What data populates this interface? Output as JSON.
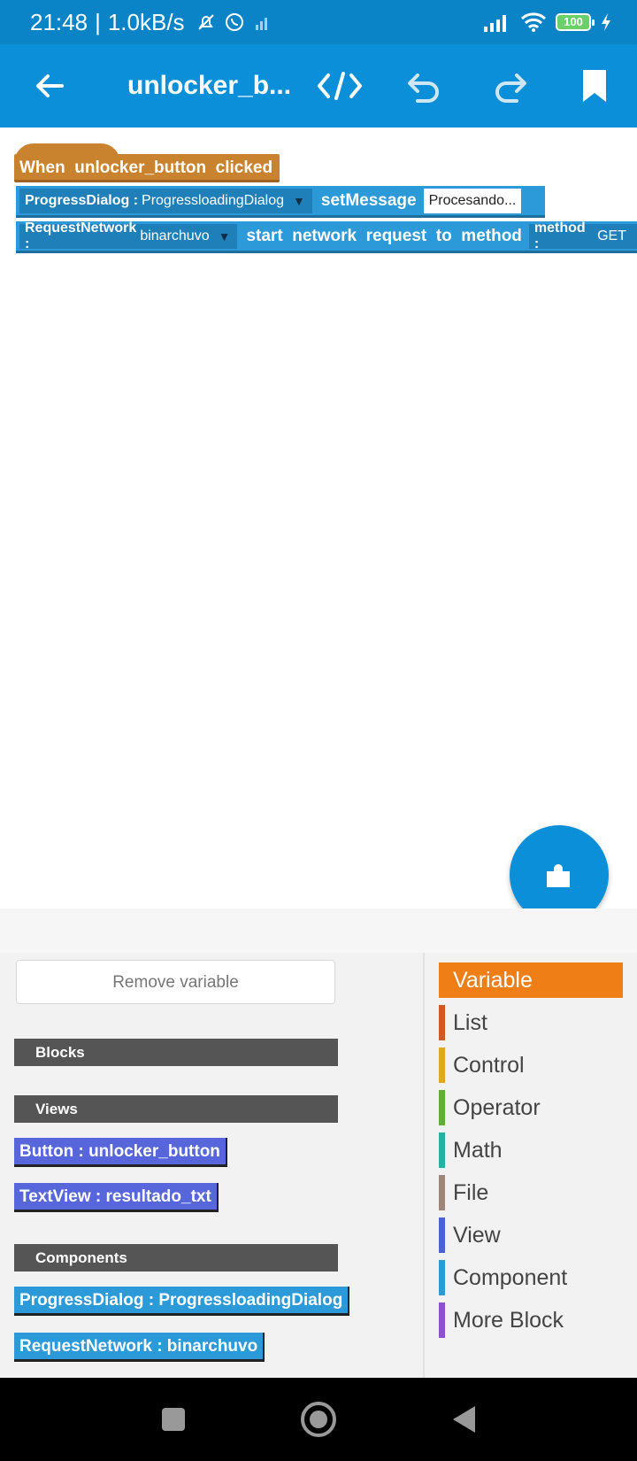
{
  "status": {
    "time": "21:48",
    "speed": "1.0kB/s",
    "battery": "100"
  },
  "toolbar": {
    "title": "unlocker_b..."
  },
  "canvas": {
    "event_label": "When  unlocker_button  clicked",
    "block1": {
      "comp_type": "ProgressDialog :",
      "comp_name": "ProgressloadingDialog",
      "method": "setMessage",
      "value": "Procesando..."
    },
    "block2": {
      "comp_type": "RequestNetwork :",
      "comp_name": "binarchuvo",
      "action": "start  network  request  to  method",
      "param_label": "method :",
      "param_value": "GET"
    }
  },
  "palette": {
    "remove_label": "Remove variable",
    "sections": {
      "blocks": "Blocks",
      "views": "Views",
      "components": "Components"
    },
    "views": [
      "Button : unlocker_button",
      "TextView : resultado_txt"
    ],
    "components": [
      "ProgressDialog : ProgressloadingDialog",
      "RequestNetwork : binarchuvo"
    ],
    "categories": [
      {
        "label": "Variable",
        "color": "#ef7e16"
      },
      {
        "label": "List",
        "color": "#d05a1e"
      },
      {
        "label": "Control",
        "color": "#e0a722"
      },
      {
        "label": "Operator",
        "color": "#5fb030"
      },
      {
        "label": "Math",
        "color": "#27b0a4"
      },
      {
        "label": "File",
        "color": "#9d8579"
      },
      {
        "label": "View",
        "color": "#4a63d4"
      },
      {
        "label": "Component",
        "color": "#2c9ad8"
      },
      {
        "label": "More Block",
        "color": "#8e4fd0"
      }
    ]
  },
  "colors": {
    "primary": "#0a8fd8",
    "event_block": "#c9832f",
    "component_block": "#2c9ad8",
    "view_block": "#5767db",
    "accent_orange": "#ef7e16"
  }
}
